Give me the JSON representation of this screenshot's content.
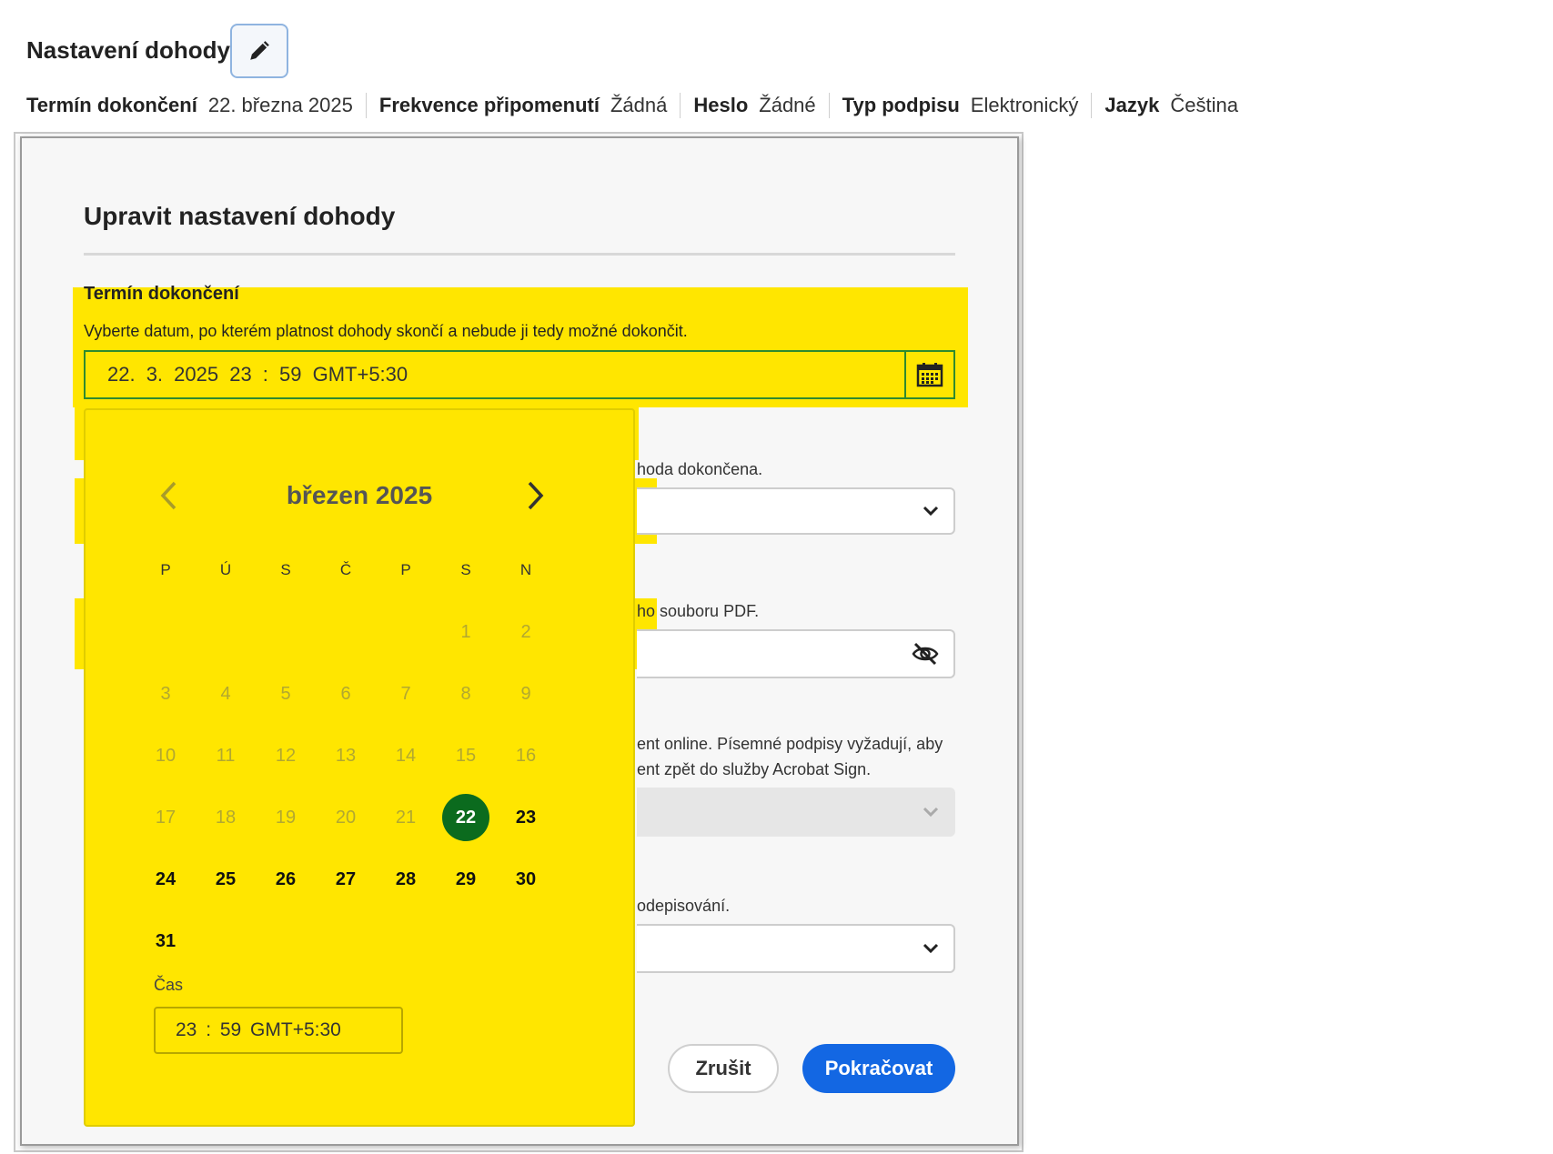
{
  "header": {
    "title": "Nastavení dohody",
    "edit_icon": "pencil-icon"
  },
  "summary": [
    {
      "label": "Termín dokončení",
      "value": "22. března 2025"
    },
    {
      "label": "Frekvence připomenutí",
      "value": "Žádná"
    },
    {
      "label": "Heslo",
      "value": "Žádné"
    },
    {
      "label": "Typ podpisu",
      "value": "Elektronický"
    },
    {
      "label": "Jazyk",
      "value": "Čeština"
    }
  ],
  "modal": {
    "title": "Upravit nastavení dohody",
    "completion": {
      "label": "Termín dokončení",
      "description": "Vyberte datum, po kterém platnost dohody skončí a nebude ji tedy možné dokončit.",
      "value": "22.   3.  2025  23 : 59  GMT+5:30",
      "calendar_icon": "calendar-icon"
    },
    "partial_texts": {
      "reminder": "hoda dokončena.",
      "password": "ho souboru PDF.",
      "signature_line1": "ent online. Písemné podpisy vyžadují, aby",
      "signature_line2": "ent zpět do služby Acrobat Sign.",
      "language": "odepisování."
    },
    "buttons": {
      "cancel": "Zrušit",
      "continue": "Pokračovat"
    }
  },
  "calendar": {
    "month_label": "březen 2025",
    "weekdays": [
      "P",
      "Ú",
      "S",
      "Č",
      "P",
      "S",
      "N"
    ],
    "weeks": [
      [
        "",
        "",
        "",
        "",
        "",
        "1",
        "2"
      ],
      [
        "3",
        "4",
        "5",
        "6",
        "7",
        "8",
        "9"
      ],
      [
        "10",
        "11",
        "12",
        "13",
        "14",
        "15",
        "16"
      ],
      [
        "17",
        "18",
        "19",
        "20",
        "21",
        "22",
        "23"
      ],
      [
        "24",
        "25",
        "26",
        "27",
        "28",
        "29",
        "30"
      ],
      [
        "31",
        "",
        "",
        "",
        "",
        "",
        ""
      ]
    ],
    "selected_day": "22",
    "time_label": "Čas",
    "time_value": "23 : 59  GMT+5:30"
  },
  "colors": {
    "highlight": "#ffe600",
    "selected_day": "#0b6b1e",
    "primary_button": "#1367e3"
  }
}
